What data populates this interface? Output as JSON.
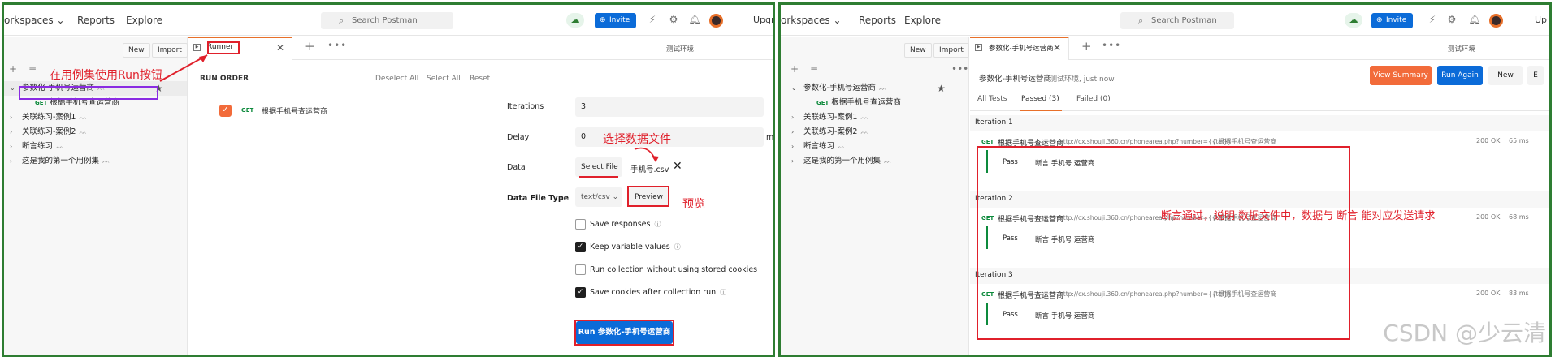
{
  "left": {
    "topbar": {
      "workspaces": "orkspaces",
      "reports": "Reports",
      "explore": "Explore",
      "search_placeholder": "Search Postman",
      "invite": "Invite",
      "upgrade": "Upgra"
    },
    "sidebar": {
      "new_label": "New",
      "import_label": "Import",
      "items": [
        {
          "label": "参数化-手机号运营商",
          "expanded": true
        },
        {
          "method": "GET",
          "label": "根据手机号查运营商"
        },
        {
          "label": "关联练习-案例1"
        },
        {
          "label": "关联练习-案例2"
        },
        {
          "label": "断言练习"
        },
        {
          "label": "这是我的第一个用例集"
        }
      ]
    },
    "tab": {
      "label": "Runner"
    },
    "env": "测试环境",
    "run_order": {
      "title": "RUN ORDER",
      "deselect_all": "Deselect All",
      "select_all": "Select All",
      "reset": "Reset",
      "request": {
        "method": "GET",
        "name": "根据手机号查运营商"
      }
    },
    "settings": {
      "iterations_label": "Iterations",
      "iterations_value": "3",
      "delay_label": "Delay",
      "delay_value": "0",
      "delay_unit": "m",
      "data_label": "Data",
      "select_file": "Select File",
      "file_name": "手机号.csv",
      "data_file_type_label": "Data File Type",
      "data_file_type_value": "text/csv",
      "preview": "Preview",
      "options": [
        {
          "label": "Save responses",
          "checked": false
        },
        {
          "label": "Keep variable values",
          "checked": true
        },
        {
          "label": "Run collection without using stored cookies",
          "checked": false
        },
        {
          "label": "Save cookies after collection run",
          "checked": true
        }
      ],
      "run_button": "Run 参数化-手机号运营商"
    },
    "annotations": {
      "run_hint": "在用例集使用Run按钮",
      "select_data_file": "选择数据文件",
      "preview_hint": "预览"
    }
  },
  "right": {
    "topbar": {
      "workspaces": "orkspaces",
      "reports": "Reports",
      "explore": "Explore",
      "search_placeholder": "Search Postman",
      "invite": "Invite",
      "upgrade": "Up"
    },
    "sidebar": {
      "new_label": "New",
      "import_label": "Import",
      "items": [
        {
          "label": "参数化-手机号运营商",
          "expanded": true
        },
        {
          "method": "GET",
          "label": "根据手机号查运营商"
        },
        {
          "label": "关联练习-案例1"
        },
        {
          "label": "关联练习-案例2"
        },
        {
          "label": "断言练习"
        },
        {
          "label": "这是我的第一个用例集"
        }
      ]
    },
    "tab": {
      "label": "参数化-手机号运营商"
    },
    "env": "测试环境",
    "run_header": {
      "collection": "参数化-手机号运营商",
      "meta": "测试环境, just now",
      "view_summary": "View Summary",
      "run_again": "Run Again",
      "new": "New",
      "cut": "E"
    },
    "filters": {
      "all": "All Tests",
      "passed": "Passed (3)",
      "failed": "Failed (0)"
    },
    "iterations": [
      {
        "title": "Iteration 1",
        "method": "GET",
        "name": "根据手机号查运营商",
        "url": "http://cx.shouji.360.cn/phonearea.php?number={{tel}}",
        "path": "/ 根据手机号查运营商",
        "status": "200 OK",
        "time": "65 ms",
        "result": "Pass",
        "assertion": "断言 手机号 运营商"
      },
      {
        "title": "Iteration 2",
        "method": "GET",
        "name": "根据手机号查运营商",
        "url": "http://cx.shouji.360.cn/phonearea.php?number={{tel}}",
        "path": "/ 根据手机号查运营商",
        "status": "200 OK",
        "time": "68 ms",
        "result": "Pass",
        "assertion": "断言 手机号 运营商"
      },
      {
        "title": "Iteration 3",
        "method": "GET",
        "name": "根据手机号查运营商",
        "url": "http://cx.shouji.360.cn/phonearea.php?number={{tel}}",
        "path": "/ 根据手机号查运营商",
        "status": "200 OK",
        "time": "83 ms",
        "result": "Pass",
        "assertion": "断言 手机号 运营商"
      }
    ],
    "annotation": "断言通过，说明 数据文件中，数据与 断言 能对应发送请求"
  },
  "watermark": "CSDN @少云清",
  "colors": {
    "frame": "#2e7d32",
    "annotation": "#e0202b",
    "primary": "#0b6bd8",
    "accent": "#f26b3a",
    "get": "#0d8a3c"
  }
}
